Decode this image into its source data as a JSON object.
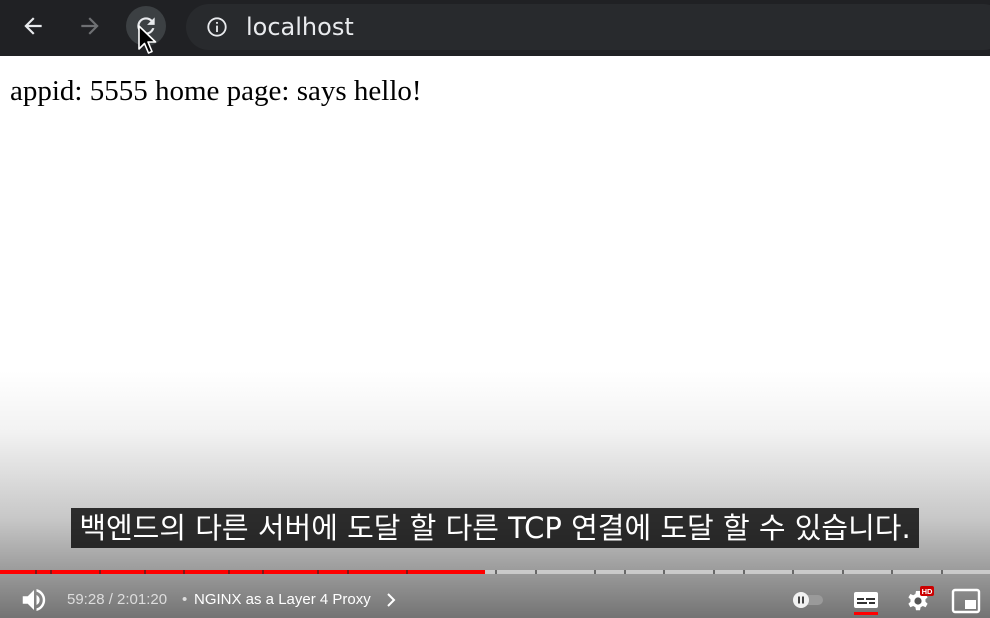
{
  "browser": {
    "url": "localhost"
  },
  "page": {
    "text": "appid: 5555 home page: says hello!"
  },
  "player": {
    "caption": "백엔드의 다른 서버에 도달 할 다른 TCP 연결에 도달 할 수 있습니다.",
    "time_display": "59:28 / 2:01:20",
    "separator": "•",
    "chapter_title": "NGINX as a Layer 4 Proxy",
    "played_fraction": 0.49,
    "chapter_markers": [
      0.035,
      0.05,
      0.1,
      0.145,
      0.185,
      0.23,
      0.265,
      0.32,
      0.35,
      0.41,
      0.5,
      0.54,
      0.6,
      0.63,
      0.67,
      0.72,
      0.75,
      0.8,
      0.85,
      0.9,
      0.95
    ],
    "hd_badge": "HD",
    "accent_color": "#ff0000"
  }
}
